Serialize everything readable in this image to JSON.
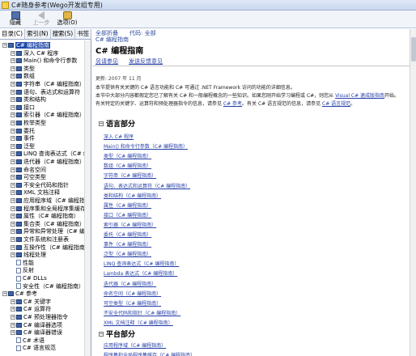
{
  "window": {
    "title": "C#随身参考(Wego开发组专用)"
  },
  "toolbar": {
    "buttons": [
      {
        "label": "隐藏",
        "icon": "hide-icon",
        "enabled": true
      },
      {
        "label": "上一步",
        "icon": "back-icon",
        "enabled": false
      },
      {
        "label": "选项(O)",
        "icon": "options-icon",
        "enabled": true
      }
    ]
  },
  "left": {
    "tabs": [
      "目录(C)",
      "索引(N)",
      "搜索(S)",
      "书签"
    ],
    "tree": [
      {
        "label": "C# 编程指南",
        "level": 0,
        "type": "book",
        "selected": true
      },
      {
        "label": "深入 C# 程序",
        "level": 1,
        "type": "book"
      },
      {
        "label": "Main() 和命令行参数",
        "level": 1,
        "type": "book"
      },
      {
        "label": "类型",
        "level": 1,
        "type": "book"
      },
      {
        "label": "数组",
        "level": 1,
        "type": "book"
      },
      {
        "label": "字符串（C# 编程指南）",
        "level": 1,
        "type": "book"
      },
      {
        "label": "语句、表达式和运算符",
        "level": 1,
        "type": "book"
      },
      {
        "label": "类和结构",
        "level": 1,
        "type": "book"
      },
      {
        "label": "接口",
        "level": 1,
        "type": "book"
      },
      {
        "label": "索引器（C# 编程指南）",
        "level": 1,
        "type": "book"
      },
      {
        "label": "枚举类型",
        "level": 1,
        "type": "book"
      },
      {
        "label": "委托",
        "level": 1,
        "type": "book"
      },
      {
        "label": "事件",
        "level": 1,
        "type": "book"
      },
      {
        "label": "泛型",
        "level": 1,
        "type": "book"
      },
      {
        "label": "LINQ 查询表达式（C# 编辑",
        "level": 1,
        "type": "book"
      },
      {
        "label": "迭代器（C# 编程指南）",
        "level": 1,
        "type": "book"
      },
      {
        "label": "命名空间",
        "level": 1,
        "type": "book"
      },
      {
        "label": "可空类型",
        "level": 1,
        "type": "book"
      },
      {
        "label": "不安全代码和指针",
        "level": 1,
        "type": "book"
      },
      {
        "label": "XML 文档注释",
        "level": 1,
        "type": "book"
      },
      {
        "label": "应用程序域（C# 编程指南）",
        "level": 1,
        "type": "book"
      },
      {
        "label": "程序集和全局程序集缓存",
        "level": 1,
        "type": "book"
      },
      {
        "label": "属性（C# 编程指南）",
        "level": 1,
        "type": "book"
      },
      {
        "label": "集合类（C# 编程指南）",
        "level": 1,
        "type": "book"
      },
      {
        "label": "异常和异常处理（C# 编程指南）",
        "level": 1,
        "type": "book"
      },
      {
        "label": "文件系统和注册表",
        "level": 1,
        "type": "book"
      },
      {
        "label": "互操作性（C# 编程指南）",
        "level": 1,
        "type": "book"
      },
      {
        "label": "线程处理",
        "level": 1,
        "type": "book"
      },
      {
        "label": "性能",
        "level": 1,
        "type": "page"
      },
      {
        "label": "反射",
        "level": 1,
        "type": "page"
      },
      {
        "label": "C# DLLs",
        "level": 1,
        "type": "page"
      },
      {
        "label": "安全性（C# 编程指南）",
        "level": 1,
        "type": "page"
      },
      {
        "label": "C# 参考",
        "level": 0,
        "type": "book"
      },
      {
        "label": "C# 关键字",
        "level": 1,
        "type": "book"
      },
      {
        "label": "C# 运算符",
        "level": 1,
        "type": "book"
      },
      {
        "label": "C# 预处理器指令",
        "level": 1,
        "type": "book"
      },
      {
        "label": "C# 编译器选项",
        "level": 1,
        "type": "book"
      },
      {
        "label": "C# 编译器错误",
        "level": 1,
        "type": "book"
      },
      {
        "label": "C# 术语",
        "level": 1,
        "type": "page"
      },
      {
        "label": "C# 语言规范",
        "level": 1,
        "type": "page"
      }
    ]
  },
  "right": {
    "breadcrumb": "全部折叠　　代码: 全部",
    "breadcrumb2": "C# 编程指南",
    "page_title": "C# 编程指南",
    "link_a": "另请参见",
    "link_b": "发送反馈意见",
    "updated": "更新: 2007 年 11 月",
    "para1": "本节提供有关关键的 C# 语言功能和 C# 可通过 .NET Framework 访问的功能的详细信息。",
    "para2a": "本节中大部分内容都假定您已了解有关 C# 和一般编程概念的一些知识。如果您刚开始学习编程或 C#，则您从 ",
    "para2_link": "Visual C# 速成版指南",
    "para2b": "开始。",
    "para3a": "有关特定的关键字、运算符和预处理器指令的信息，请参见 ",
    "para3_link1": "C# 参考",
    "para3b": "。有关 C# 语言规范的信息，请参见 ",
    "para3_link2": "C# 语言规范",
    "para3c": "。",
    "section1": "语言部分",
    "section1_links": [
      "深入 C# 程序",
      "Main() 和命令行参数（C# 编程指南）",
      "类型（C# 编程指南）",
      "数组（C# 编程指南）",
      "字符串（C# 编程指南）",
      "语句、表达式和运算符（C# 编程指南）",
      "类和结构（C# 编程指南）",
      "属性（C# 编程指南）",
      "接口（C# 编程指南）",
      "索引器（C# 编程指南）",
      "委托（C# 编程指南）",
      "事件（C# 编程指南）",
      "泛型（C# 编程指南）",
      "LINQ 查询表达式（C# 编程指南）",
      "Lambda 表达式（C# 编程指南）",
      "迭代器（C# 编程指南）",
      "命名空间（C# 编程指南）",
      "可空类型（C# 编程指南）",
      "不安全代码和指针（C# 编程指南）",
      "XML 文档注释（C# 编程指南）"
    ],
    "section2": "平台部分",
    "section2_links": [
      "应用程序域（C# 编程指南）",
      "程序集和全局程序集缓存（C# 编程指南）"
    ]
  }
}
